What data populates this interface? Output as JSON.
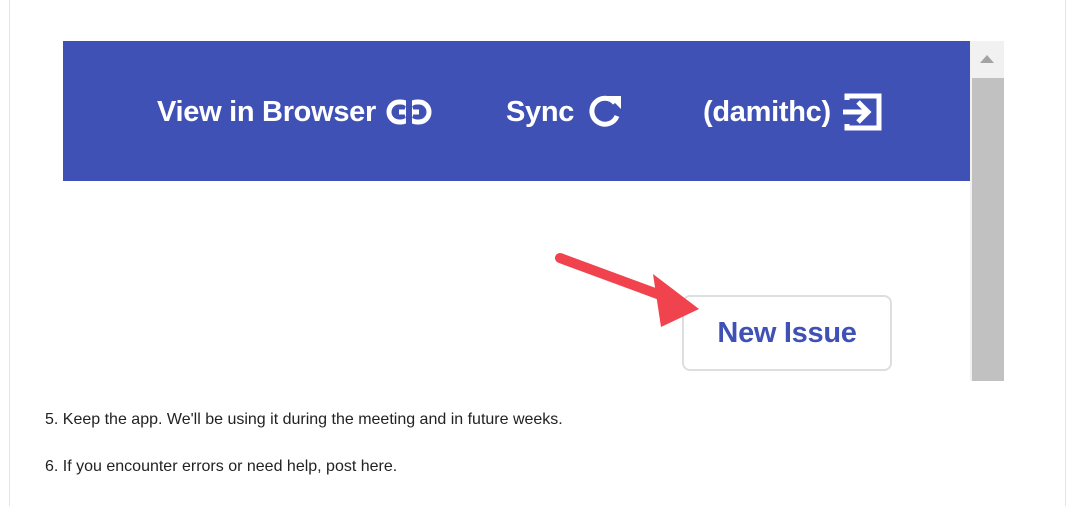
{
  "app_bar": {
    "background_color": "#3f51b5",
    "view_in_browser_label": "View in Browser",
    "view_in_browser_icon": "link-icon",
    "sync_label": "Sync",
    "sync_icon": "refresh-icon",
    "user_label": "(damithc)",
    "user_icon": "logout-icon"
  },
  "main": {
    "new_issue_label": "New Issue",
    "annotation_arrow_color": "#f0434e"
  },
  "instructions": [
    "5. Keep the app. We'll be using it during the meeting and in future weeks.",
    "6. If you encounter errors or need help, post here."
  ]
}
